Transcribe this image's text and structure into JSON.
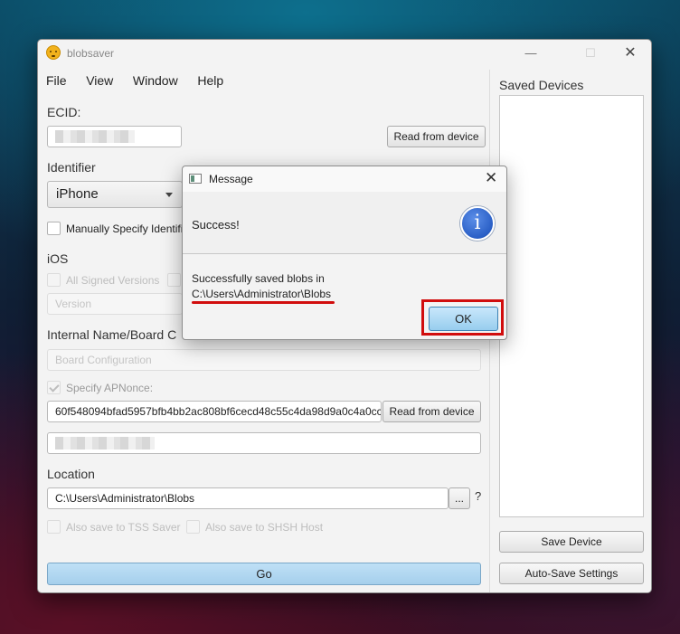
{
  "window": {
    "title": "blobsaver",
    "controls": {
      "minimize": "—",
      "maximize": "☐",
      "close": "✕"
    }
  },
  "menu": [
    "File",
    "View",
    "Window",
    "Help"
  ],
  "form": {
    "ecid_label": "ECID:",
    "ecid_read_button": "Read from device",
    "identifier_label": "Identifier",
    "identifier_value": "iPhone",
    "manual_identifier_label": "Manually Specify Identifi",
    "ios_label": "iOS",
    "all_signed_label": "All Signed Versions",
    "version_placeholder": "Version",
    "internal_name_label": "Internal Name/Board C",
    "board_config_placeholder": "Board Configuration",
    "apnonce_label": "Specify APNonce:",
    "apnonce_value": "60f548094bfad5957bfb4bb2ac808bf6cecd48c55c4da98d9a0c4a0cc",
    "apnonce_read_button": "Read from device",
    "location_label": "Location",
    "location_value": "C:\\Users\\Administrator\\Blobs",
    "browse_button": "...",
    "help_mark": "?",
    "tss_saver_label": "Also save to TSS Saver",
    "shsh_host_label": "Also save to SHSH Host",
    "go_button": "Go"
  },
  "saved_devices": {
    "title": "Saved Devices",
    "save_button": "Save Device",
    "autosave_button": "Auto-Save Settings"
  },
  "dialog": {
    "title": "Message",
    "close": "✕",
    "header": "Success!",
    "info_glyph": "i",
    "body_line1": "Successfully saved blobs in",
    "body_line2": "C:\\Users\\Administrator\\Blobs",
    "ok_button": "OK"
  },
  "colors": {
    "highlight": "#d10d0d",
    "info_blue": "#2a5fc6",
    "go_button": "#b3d8f1"
  }
}
